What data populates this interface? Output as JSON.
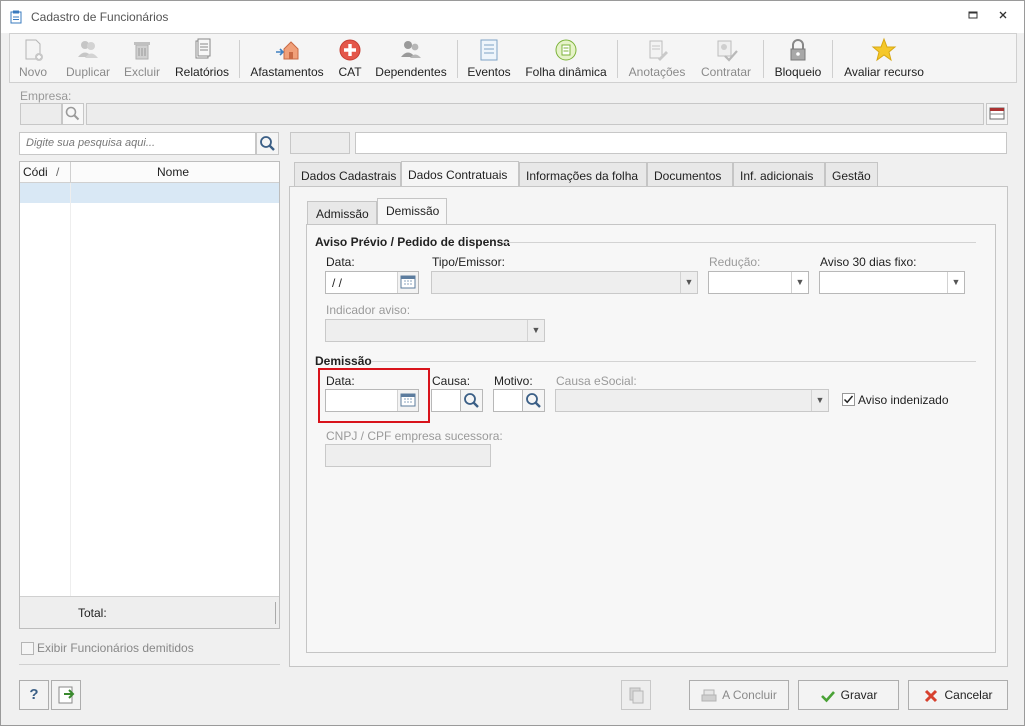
{
  "window": {
    "title": "Cadastro de Funcionários",
    "restore_icon": "restore-icon",
    "close_icon": "close-icon"
  },
  "toolbar": {
    "novo": "Novo",
    "duplicar": "Duplicar",
    "excluir": "Excluir",
    "relatorios": "Relatórios",
    "afastamentos": "Afastamentos",
    "cat": "CAT",
    "dependentes": "Dependentes",
    "eventos": "Eventos",
    "folha_dinamica": "Folha dinâmica",
    "anotacoes": "Anotações",
    "contratar": "Contratar",
    "bloqueio": "Bloqueio",
    "avaliar_recurso": "Avaliar recurso"
  },
  "empresa": {
    "label": "Empresa:",
    "code": "",
    "name": ""
  },
  "search": {
    "placeholder": "Digite sua pesquisa aqui..."
  },
  "grid": {
    "col_codigo": "Códi",
    "sort_indicator": "/",
    "col_nome": "Nome",
    "total_label": "Total:"
  },
  "exibir_demitidos": {
    "label": "Exibir Funcionários demitidos",
    "checked": false
  },
  "tabs": [
    {
      "label": "Dados Cadastrais",
      "active": false
    },
    {
      "label": "Dados Contratuais",
      "active": true
    },
    {
      "label": "Informações da folha",
      "active": false
    },
    {
      "label": "Documentos",
      "active": false
    },
    {
      "label": "Inf. adicionais",
      "active": false
    },
    {
      "label": "Gestão",
      "active": false
    }
  ],
  "subtabs": [
    {
      "label": "Admissão",
      "active": false
    },
    {
      "label": "Demissão",
      "active": true
    }
  ],
  "aviso": {
    "section_title": "Aviso Prévio / Pedido de dispensa",
    "data_label": "Data:",
    "data_value": " /  /",
    "tipo_label": "Tipo/Emissor:",
    "reducao_label": "Redução:",
    "aviso30_label": "Aviso 30 dias fixo:",
    "indicador_label": "Indicador aviso:"
  },
  "demissao": {
    "section_title": "Demissão",
    "data_label": "Data:",
    "data_value": "",
    "causa_label": "Causa:",
    "motivo_label": "Motivo:",
    "causa_esocial_label": "Causa eSocial:",
    "aviso_indenizado_label": "Aviso indenizado",
    "aviso_indenizado_checked": true,
    "cnpj_label": "CNPJ / CPF empresa sucessora:"
  },
  "footer": {
    "help": "?",
    "concluir": "A Concluir",
    "gravar": "Gravar",
    "cancelar": "Cancelar"
  },
  "colors": {
    "highlight": "#d8131b",
    "selected_row": "#d9e8f5"
  }
}
